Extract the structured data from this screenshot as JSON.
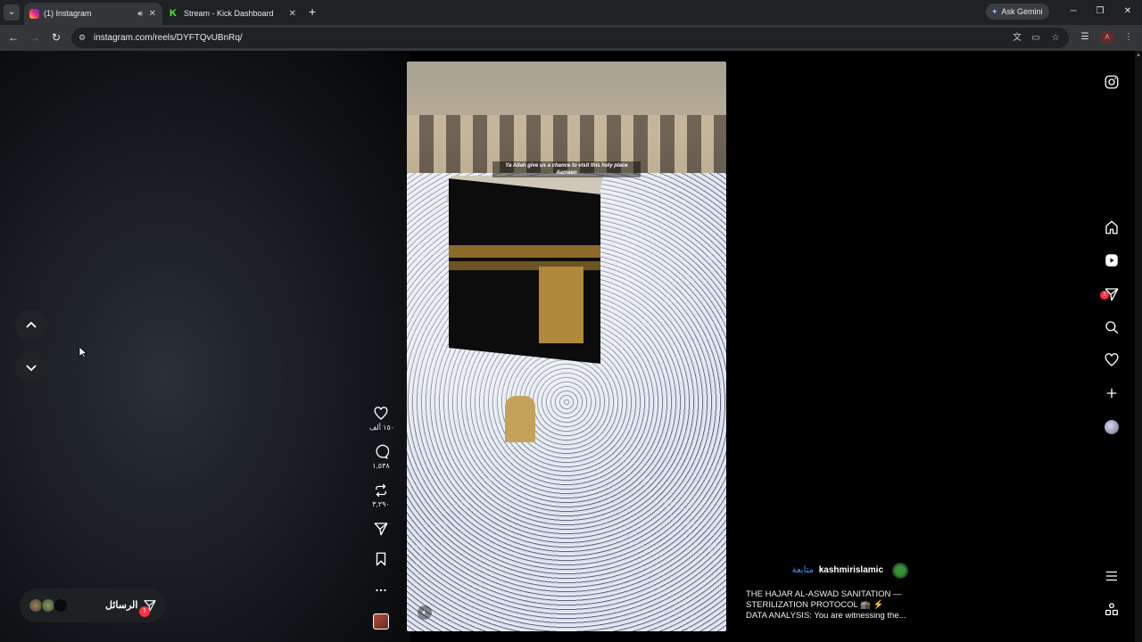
{
  "browser": {
    "tabs": [
      {
        "title": "(1) Instagram",
        "favicon": "instagram-icon",
        "active": true,
        "audio": true
      },
      {
        "title": "Stream - Kick Dashboard",
        "favicon": "kick-icon",
        "active": false
      }
    ],
    "new_tab_symbol": "+",
    "ask_gemini_label": "Ask Gemini",
    "url": "instagram.com/reels/DYFTQvUBnRq/",
    "profile_initial": "A"
  },
  "reel": {
    "video_caption_line1": "Ya Allah give us a chance to visit this holy place",
    "video_caption_line2": "Aameen",
    "likes": "١٥٠ ألف",
    "comments": "١,٥٣٨",
    "reposts": "٣,٢٩٠",
    "author": {
      "username": "kashmirislamic",
      "separator": "•",
      "follow_label": "متابعة"
    },
    "caption_lines": [
      "THE HAJAR AL-ASWAD SANITATION —",
      "STERILIZATION PROTOCOL 🕋 ⚡",
      "DATA ANALYSIS: You are witnessing the..."
    ]
  },
  "messages": {
    "label": "الرسائل",
    "badge": "1"
  },
  "right_nav": {
    "messages_badge": "1"
  },
  "colors": {
    "follow_link": "#4a90f5",
    "notification_badge": "#ff3040",
    "page_background": "#000000",
    "browser_frame": "#202124"
  }
}
